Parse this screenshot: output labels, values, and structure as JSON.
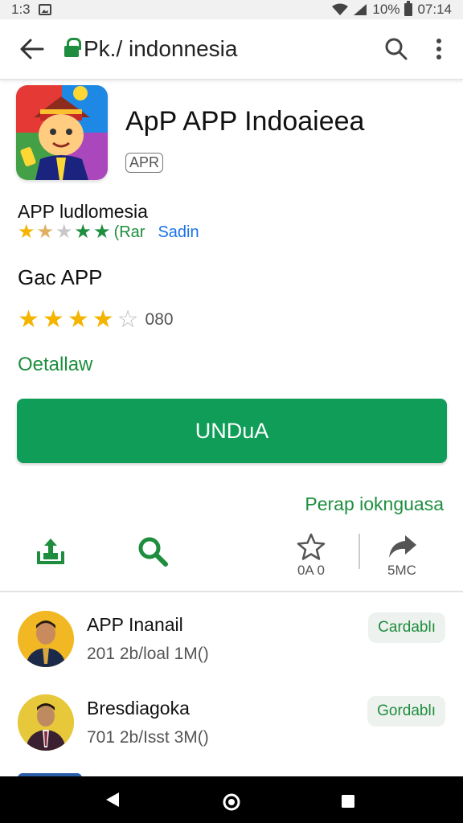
{
  "status_bar": {
    "time_left": "1:3",
    "battery": "10%",
    "time_right": "07:14"
  },
  "toolbar": {
    "url": "Pk./ indonnesia"
  },
  "app": {
    "title": "ApP APP Indoaieea",
    "badge": "APR",
    "developer": "APP ludlomesia",
    "small_rating_text": "(Rar",
    "small_rating_link": "Sadin",
    "game_title": "Gac APP",
    "review_count": "080",
    "details_label": "Oetallaw",
    "install_label": "UNDuA",
    "languages_label": "Perap ioknguasa"
  },
  "actions": [
    {
      "icon": "share-icon",
      "label": ""
    },
    {
      "icon": "search-icon",
      "label": ""
    },
    {
      "icon": "star-outline-icon",
      "label": "0A 0"
    },
    {
      "icon": "forward-share-icon",
      "label": "5MC"
    }
  ],
  "list": [
    {
      "name": "APP Inanail",
      "meta": "201 2b/loal 1M()",
      "button": "Cardablı"
    },
    {
      "name": "Bresdiagoka",
      "meta": "701 2b/Isst 3M()",
      "button": "Gordablı"
    }
  ],
  "colors": {
    "accent": "#0f9d58",
    "link": "#1e8e3e",
    "blue": "#1a73e8",
    "star": "#f4b400"
  }
}
